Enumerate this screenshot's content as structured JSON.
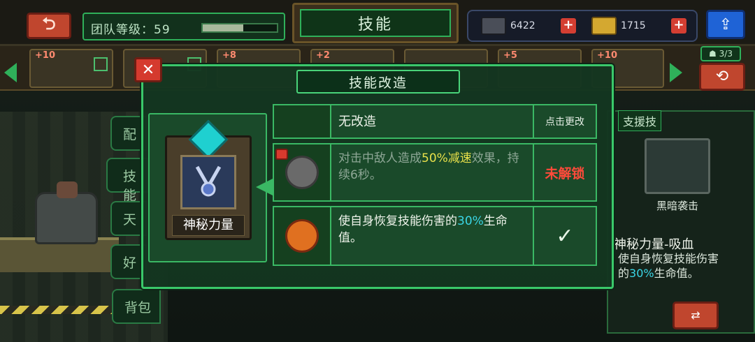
{
  "topbar": {
    "back_icon": "back-arrow-icon",
    "team_level_label": "团队等级：59",
    "team_level_progress": 0.55,
    "title": "技能",
    "resources": [
      {
        "icon": "cash-icon",
        "value": "6422"
      },
      {
        "icon": "gold-bar-icon",
        "value": "1715"
      }
    ],
    "share_icon": "share-icon"
  },
  "heroes": [
    {
      "level": "+10"
    },
    {
      "level": ""
    },
    {
      "level": "+8"
    },
    {
      "level": "+2"
    },
    {
      "level": ""
    },
    {
      "level": "+5"
    },
    {
      "level": "+10"
    }
  ],
  "team_count": "3/3",
  "side_tabs": [
    "配",
    "技能",
    "天",
    "好",
    "背包"
  ],
  "support": {
    "title": "支援技",
    "skill_label": "黑暗袭击",
    "skill_name": "神秘力量-吸血",
    "desc_before": "使自身恢复技能伤害的",
    "desc_value": "30%",
    "desc_after": "生命值。"
  },
  "modal": {
    "title": "技能改造",
    "skill_name": "神秘力量",
    "rows": [
      {
        "desc": "无改造",
        "action": "点击更改"
      },
      {
        "desc_before": "对击中敌人造成",
        "desc_value": "50%减速",
        "desc_after": "效果，持续6秒。",
        "action": "未解锁"
      },
      {
        "desc_before": "使自身恢复技能伤害的",
        "desc_value": "30%",
        "desc_after": "生命值。",
        "action": "✓"
      }
    ]
  },
  "colors": {
    "accent_green": "#3ac86a",
    "danger_red": "#d53a2e",
    "highlight_yellow": "#e8e04a",
    "highlight_cyan": "#3ad6e6"
  }
}
